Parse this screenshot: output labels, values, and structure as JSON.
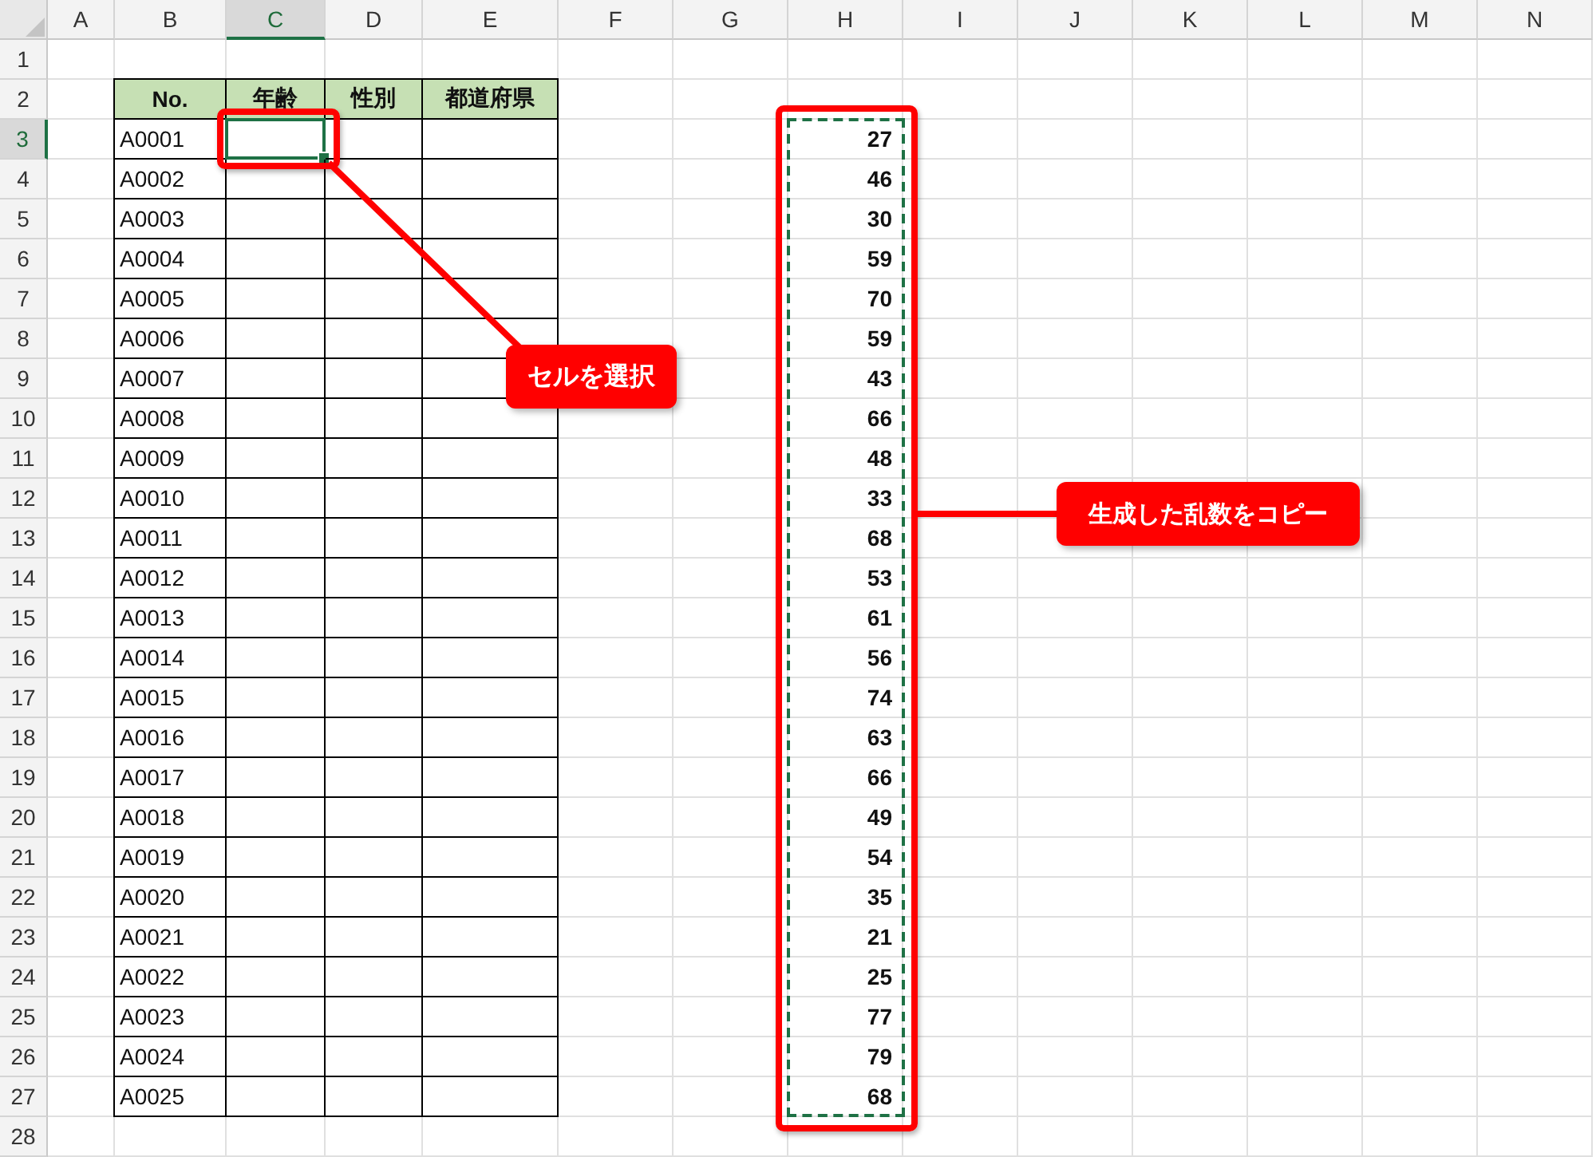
{
  "columns": [
    {
      "label": "A",
      "selected": false
    },
    {
      "label": "B",
      "selected": false
    },
    {
      "label": "C",
      "selected": true
    },
    {
      "label": "D",
      "selected": false
    },
    {
      "label": "E",
      "selected": false
    },
    {
      "label": "F",
      "selected": false
    },
    {
      "label": "G",
      "selected": false
    },
    {
      "label": "H",
      "selected": false
    },
    {
      "label": "I",
      "selected": false
    },
    {
      "label": "J",
      "selected": false
    },
    {
      "label": "K",
      "selected": false
    },
    {
      "label": "L",
      "selected": false
    },
    {
      "label": "M",
      "selected": false
    },
    {
      "label": "N",
      "selected": false
    }
  ],
  "rows": [
    {
      "label": "1",
      "selected": false
    },
    {
      "label": "2",
      "selected": false
    },
    {
      "label": "3",
      "selected": true
    },
    {
      "label": "4",
      "selected": false
    },
    {
      "label": "5",
      "selected": false
    },
    {
      "label": "6",
      "selected": false
    },
    {
      "label": "7",
      "selected": false
    },
    {
      "label": "8",
      "selected": false
    },
    {
      "label": "9",
      "selected": false
    },
    {
      "label": "10",
      "selected": false
    },
    {
      "label": "11",
      "selected": false
    },
    {
      "label": "12",
      "selected": false
    },
    {
      "label": "13",
      "selected": false
    },
    {
      "label": "14",
      "selected": false
    },
    {
      "label": "15",
      "selected": false
    },
    {
      "label": "16",
      "selected": false
    },
    {
      "label": "17",
      "selected": false
    },
    {
      "label": "18",
      "selected": false
    },
    {
      "label": "19",
      "selected": false
    },
    {
      "label": "20",
      "selected": false
    },
    {
      "label": "21",
      "selected": false
    },
    {
      "label": "22",
      "selected": false
    },
    {
      "label": "23",
      "selected": false
    },
    {
      "label": "24",
      "selected": false
    },
    {
      "label": "25",
      "selected": false
    },
    {
      "label": "26",
      "selected": false
    },
    {
      "label": "27",
      "selected": false
    },
    {
      "label": "28",
      "selected": false
    }
  ],
  "table": {
    "headers": [
      "No.",
      "年齢",
      "性別",
      "都道府県"
    ],
    "ids": [
      "A0001",
      "A0002",
      "A0003",
      "A0004",
      "A0005",
      "A0006",
      "A0007",
      "A0008",
      "A0009",
      "A0010",
      "A0011",
      "A0012",
      "A0013",
      "A0014",
      "A0015",
      "A0016",
      "A0017",
      "A0018",
      "A0019",
      "A0020",
      "A0021",
      "A0022",
      "A0023",
      "A0024",
      "A0025"
    ]
  },
  "random_numbers": [
    "27",
    "46",
    "30",
    "59",
    "70",
    "59",
    "43",
    "66",
    "48",
    "33",
    "68",
    "53",
    "61",
    "56",
    "74",
    "63",
    "66",
    "49",
    "54",
    "35",
    "21",
    "25",
    "77",
    "79",
    "68"
  ],
  "callouts": [
    "セルを選択",
    "生成した乱数をコピー"
  ]
}
